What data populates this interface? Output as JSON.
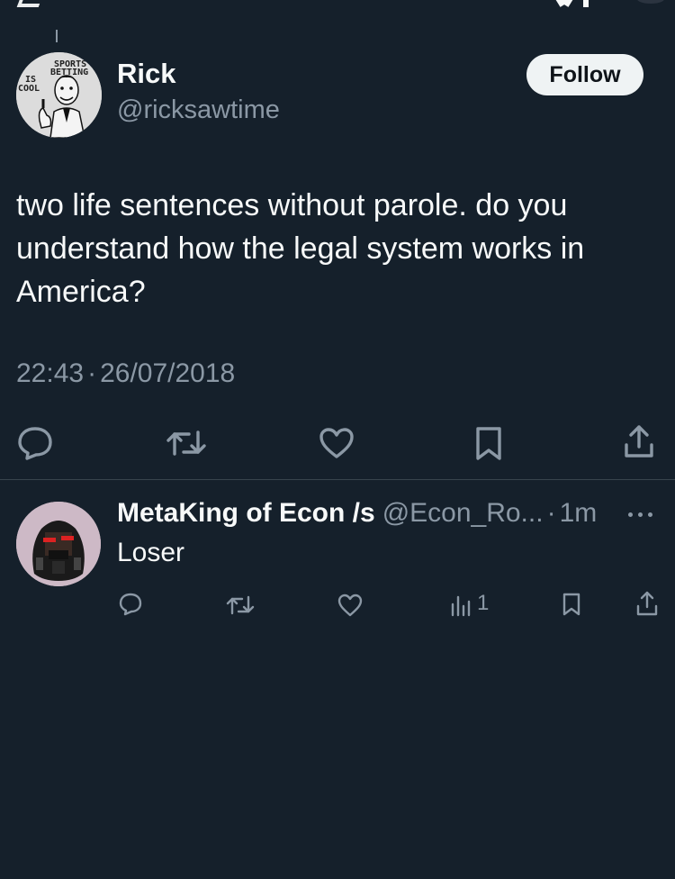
{
  "tweet": {
    "author_name": "Rick",
    "author_handle": "@ricksawtime",
    "follow_label": "Follow",
    "text": "two life sentences without parole. do you understand how the legal system works in America?",
    "time": "22:43",
    "separator": "·",
    "date": "26/07/2018",
    "avatar_text": [
      "SPORTS",
      "BETTING",
      "IS",
      "COOL"
    ],
    "icons": [
      "reply-icon",
      "retweet-icon",
      "like-icon",
      "bookmark-icon",
      "share-icon"
    ]
  },
  "reply": {
    "author_name": "MetaKing of Econ /s",
    "author_handle": "@Econ_Ro...",
    "separator": "·",
    "time": "1m",
    "text": "Loser",
    "views": "1",
    "icons": [
      "reply-icon",
      "retweet-icon",
      "like-icon",
      "views-icon",
      "bookmark-icon",
      "share-icon",
      "more-icon"
    ]
  },
  "colors": {
    "background": "#15202b",
    "primary_text": "#f7f9f9",
    "secondary_text": "#8b98a5",
    "divider": "#38444d",
    "follow_bg": "#eff3f4"
  }
}
